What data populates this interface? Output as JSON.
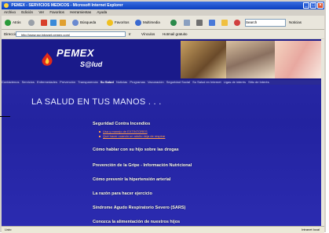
{
  "window": {
    "title": "PEMEX - SERVICIOS MEDICOS - Microsoft Internet Explorer"
  },
  "menu": [
    "Archivo",
    "Edición",
    "Ver",
    "Favoritos",
    "Herramientas",
    "Ayuda"
  ],
  "toolbar": {
    "back": "Atrás",
    "search": "Búsqueda",
    "favorites": "Favoritos",
    "multimedia": "Multimedia",
    "search_box": "Search",
    "news": "Noticias"
  },
  "address": {
    "label": "Dirección",
    "url": "http://www.ssr.intranet.pemex.com/",
    "go": "Ir",
    "links": "Vínculos",
    "hotmail": "Hotmail gratuito"
  },
  "site": {
    "brand": "PEMEX",
    "sub_brand": "S@lud",
    "nav": [
      "Contáctenos",
      "Servicios",
      "Enfermedades",
      "Prevención",
      "Transparencia",
      "Su Salud",
      "Noticias",
      "Programas",
      "Vacunación",
      "Seguridad Social",
      "Su Salud en Internet",
      "Ligas de interés",
      "Sitio de Interés"
    ],
    "heading": "LA SALUD EN TUS MANOS . . .",
    "items": [
      "Seguridad Contra Incendios",
      "Cómo hablar con su hijo sobre las drogas",
      "Prevención de la Gripe - Información Nutricional",
      "Cómo prevenir la hipertensión arterial",
      "La razón para hacer ejercicio",
      "Síndrome Agudo Respiratorio Severo (SARS)",
      "Conozca la alimentación de nuestros hijos"
    ],
    "subitems": [
      "Usa y manejo de EXTINTORES",
      "Qué hacer cuando un adulto deja de respirar"
    ]
  },
  "status": {
    "left": "Listo",
    "zone": "Intranet local"
  }
}
